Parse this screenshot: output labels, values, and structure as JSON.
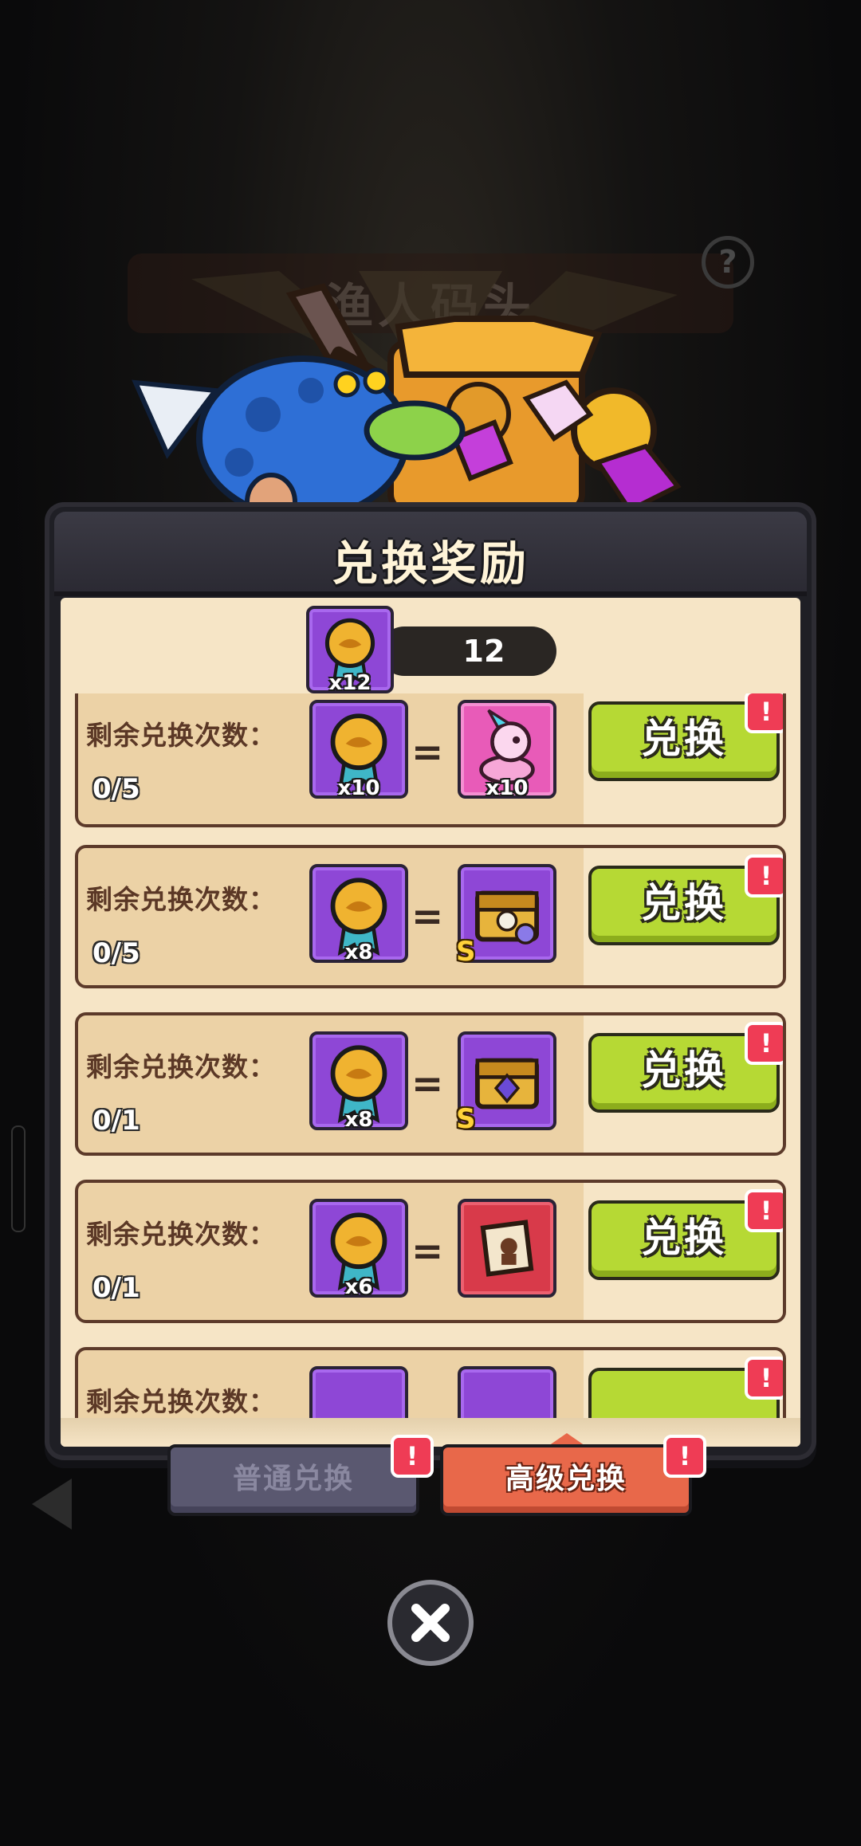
{
  "background": {
    "location_title": "渔人码头",
    "help_symbol": "?"
  },
  "panel": {
    "title": "兑换奖励",
    "currency": {
      "icon": "token-medal-icon",
      "badge": "x12",
      "amount": "12"
    }
  },
  "exchanges": [
    {
      "label": "剩余兑换次数：",
      "count": "0/5",
      "cost_qty": "x10",
      "reward_icon": "pink-pet-creature-icon",
      "reward_qty": "x10",
      "reward_grade": "",
      "button": "兑换",
      "alert": "!"
    },
    {
      "label": "剩余兑换次数：",
      "count": "0/5",
      "cost_qty": "x8",
      "reward_icon": "skull-chest-icon",
      "reward_qty": "",
      "reward_grade": "S",
      "button": "兑换",
      "alert": "!"
    },
    {
      "label": "剩余兑换次数：",
      "count": "0/1",
      "cost_qty": "x8",
      "reward_icon": "gem-chest-icon",
      "reward_qty": "",
      "reward_grade": "S",
      "button": "兑换",
      "alert": "!"
    },
    {
      "label": "剩余兑换次数：",
      "count": "0/1",
      "cost_qty": "x6",
      "reward_icon": "scroll-icon",
      "reward_qty": "",
      "reward_grade": "",
      "button": "兑换",
      "alert": "!"
    },
    {
      "label": "剩余兑换次数：",
      "count": "",
      "cost_qty": "",
      "reward_icon": "",
      "reward_qty": "",
      "reward_grade": "",
      "button": "",
      "alert": "!"
    }
  ],
  "tabs": [
    {
      "label": "普通兑换",
      "alert": "!"
    },
    {
      "label": "高级兑换",
      "alert": "!"
    }
  ]
}
